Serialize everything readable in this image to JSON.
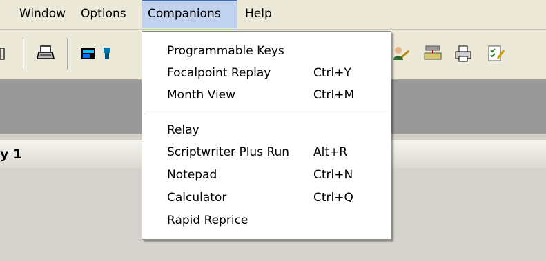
{
  "menubar": {
    "items": [
      "Window",
      "Options",
      "Companions",
      "Help"
    ]
  },
  "toolbar": {
    "icons": [
      "print-icon",
      "window-layout-icon",
      "tools-icon",
      "user-edit-icon",
      "keyboard-network-icon",
      "printer-icon",
      "checklist-icon"
    ]
  },
  "child_window": {
    "title_fragment": "y 1"
  },
  "companions_menu": {
    "items": [
      {
        "label": "Programmable Keys",
        "shortcut": ""
      },
      {
        "label": "Focalpoint Replay",
        "shortcut": "Ctrl+Y"
      },
      {
        "label": "Month View",
        "shortcut": "Ctrl+M"
      },
      {
        "label": "Relay",
        "shortcut": ""
      },
      {
        "label": "Scriptwriter Plus Run",
        "shortcut": "Alt+R"
      },
      {
        "label": "Notepad",
        "shortcut": "Ctrl+N"
      },
      {
        "label": "Calculator",
        "shortcut": "Ctrl+Q"
      },
      {
        "label": "Rapid Reprice",
        "shortcut": ""
      }
    ]
  },
  "colors": {
    "menu_highlight": "#c1d2ee",
    "menu_border": "#316ac5",
    "strip": "#999999"
  }
}
